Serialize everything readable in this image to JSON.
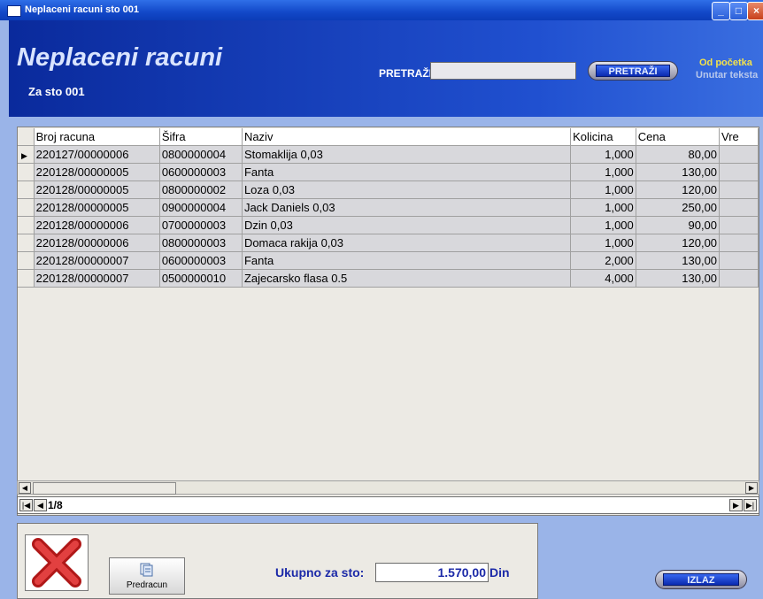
{
  "window": {
    "title": "Neplaceni racuni sto 001"
  },
  "header": {
    "title": "Neplaceni racuni",
    "subtitle": "Za sto 001",
    "search_label": "PRETRAŽI",
    "search_value": "",
    "search_button": "PRETRAŽI",
    "option_start": "Od početka",
    "option_inside": "Unutar teksta"
  },
  "grid": {
    "columns": [
      "Broj racuna",
      "Šifra",
      "Naziv",
      "Kolicina",
      "Cena",
      "Vre"
    ],
    "rows": [
      [
        "220127/00000006",
        "0800000004",
        "Stomaklija 0,03",
        "1,000",
        "80,00"
      ],
      [
        "220128/00000005",
        "0600000003",
        "Fanta",
        "1,000",
        "130,00"
      ],
      [
        "220128/00000005",
        "0800000002",
        "Loza 0,03",
        "1,000",
        "120,00"
      ],
      [
        "220128/00000005",
        "0900000004",
        "Jack Daniels 0,03",
        "1,000",
        "250,00"
      ],
      [
        "220128/00000006",
        "0700000003",
        "Dzin 0,03",
        "1,000",
        "90,00"
      ],
      [
        "220128/00000006",
        "0800000003",
        "Domaca rakija 0,03",
        "1,000",
        "120,00"
      ],
      [
        "220128/00000007",
        "0600000003",
        "Fanta",
        "2,000",
        "130,00"
      ],
      [
        "220128/00000007",
        "0500000010",
        "Zajecarsko flasa 0.5",
        "4,000",
        "130,00"
      ]
    ]
  },
  "navigator": {
    "position": "1/8"
  },
  "footer": {
    "predracun_label": "Predracun",
    "total_label": "Ukupno za sto:",
    "total_value": "1.570,00",
    "currency": "Din",
    "exit_label": "IZLAZ"
  },
  "colors": {
    "accent": "#1c2aa8",
    "header_dark": "#0a2a9c",
    "option_highlight": "#f4e24a"
  }
}
